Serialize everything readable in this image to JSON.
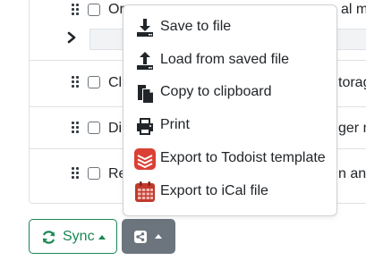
{
  "list": {
    "rows": [
      {
        "left": "Or",
        "right": "al ma"
      },
      {
        "left": "Cl",
        "right": "torag"
      },
      {
        "left": "Di",
        "right": "ger m"
      },
      {
        "left": "Re",
        "right": "n an"
      }
    ]
  },
  "toolbar": {
    "sync_label": "Sync"
  },
  "menu": {
    "items": [
      {
        "label": "Save to file",
        "icon": "download-icon"
      },
      {
        "label": "Load from saved file",
        "icon": "upload-icon"
      },
      {
        "label": "Copy to clipboard",
        "icon": "copy-icon"
      },
      {
        "label": "Print",
        "icon": "print-icon"
      },
      {
        "label": "Export to Todoist template",
        "icon": "todoist-icon"
      },
      {
        "label": "Export to iCal file",
        "icon": "calendar-icon"
      }
    ]
  },
  "colors": {
    "sync_green": "#198754",
    "share_gray": "#6c757d",
    "todoist_red": "#db4035",
    "ical_red": "#c0392b"
  }
}
